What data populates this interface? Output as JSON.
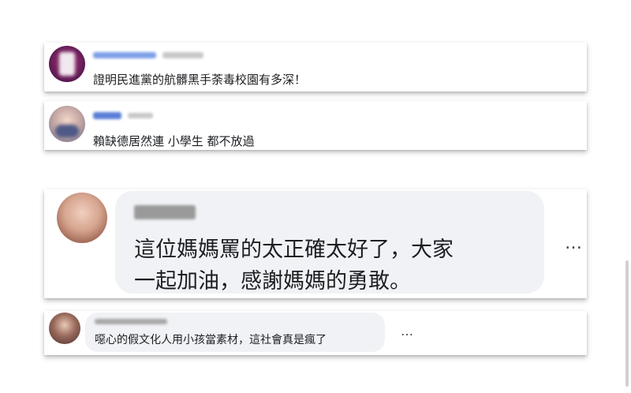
{
  "comments": [
    {
      "id": "c1",
      "text": "證明民進黨的航髒黑手荼毒校園有多深！",
      "avatar_icon": "user-avatar-icon"
    },
    {
      "id": "c2",
      "text": "賴缺德居然連 小學生 都不放過",
      "avatar_icon": "user-avatar-icon"
    },
    {
      "id": "c3",
      "text_line1": "這位媽媽罵的太正確太好了，大家",
      "text_line2": "一起加油，感謝媽媽的勇敢。",
      "more_label": "…",
      "avatar_icon": "user-avatar-icon"
    },
    {
      "id": "c4",
      "text": "噁心的假文化人用小孩當素材，這社會真是瘋了",
      "more_label": "…",
      "avatar_icon": "user-avatar-icon"
    }
  ],
  "colors": {
    "bubble": "#f0f2f5",
    "name_blur": "#5b7fd6",
    "text": "#1c1e21"
  }
}
